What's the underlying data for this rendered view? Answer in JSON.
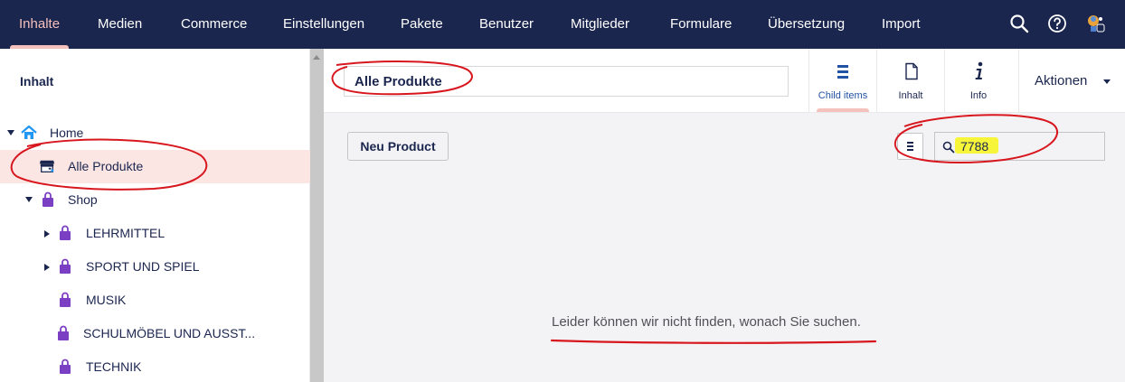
{
  "topnav": {
    "items": [
      "Inhalte",
      "Medien",
      "Commerce",
      "Einstellungen",
      "Pakete",
      "Benutzer",
      "Mitglieder",
      "Formulare",
      "Übersetzung",
      "Import"
    ],
    "active_index": 0,
    "icons": [
      "search-icon",
      "help-icon",
      "user-avatar-icon"
    ]
  },
  "sidebar": {
    "title": "Inhalt",
    "tree": [
      {
        "label": "Home",
        "icon": "home-icon",
        "caret": "expanded"
      },
      {
        "label": "Alle Produkte",
        "icon": "store-icon",
        "selected": true
      },
      {
        "label": "Shop",
        "icon": "bag-lock-icon",
        "caret": "expanded"
      },
      {
        "label": "LEHRMITTEL",
        "icon": "bag-lock-icon",
        "caret": "collapsed"
      },
      {
        "label": "SPORT UND SPIEL",
        "icon": "bag-lock-icon",
        "caret": "collapsed"
      },
      {
        "label": "MUSIK",
        "icon": "bag-lock-icon"
      },
      {
        "label": "SCHULMÖBEL UND AUSST...",
        "icon": "bag-lock-icon"
      },
      {
        "label": "TECHNIK",
        "icon": "bag-lock-icon"
      }
    ]
  },
  "editor": {
    "name_value": "Alle Produkte",
    "apps": [
      {
        "label": "Child items",
        "icon": "list-icon",
        "active": true
      },
      {
        "label": "Inhalt",
        "icon": "document-icon"
      },
      {
        "label": "Info",
        "icon": "info-icon"
      }
    ],
    "actions_label": "Aktionen",
    "new_button_label": "Neu Product",
    "search_value": "7788",
    "empty_message": "Leider können wir nicht finden, wonach Sie suchen."
  },
  "colors": {
    "nav_bg": "#1b264f",
    "nav_active": "#f5c1bc",
    "selected_row": "#fce6e4",
    "body_bg": "#f3f3f5",
    "annotation_red": "#d8161e",
    "highlight_yellow": "#f7f53a",
    "bag_purple": "#7b3fc4",
    "home_blue": "#2196f3"
  }
}
